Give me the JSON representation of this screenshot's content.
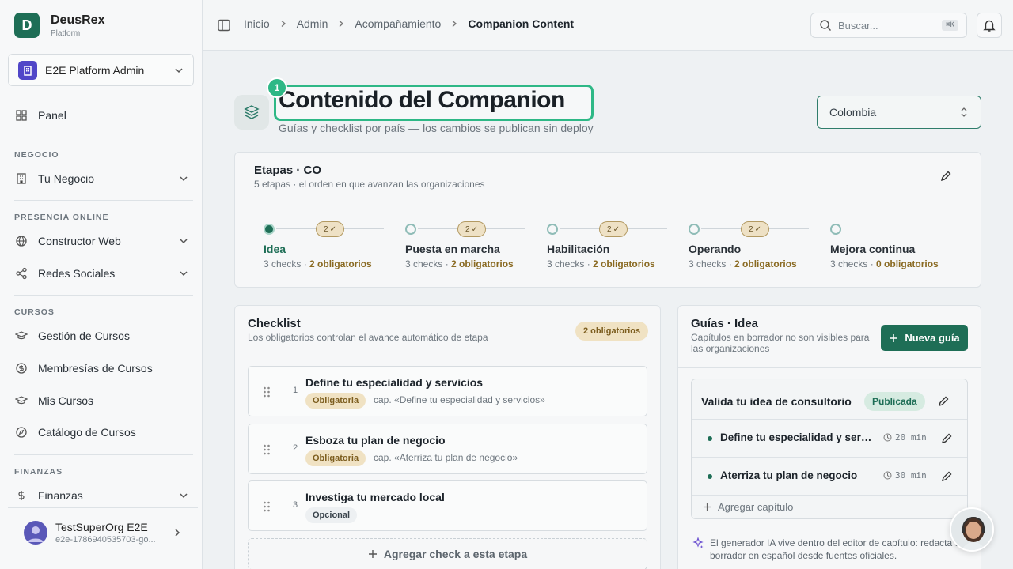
{
  "brand": {
    "name": "DeusRex",
    "sub": "Platform",
    "letter": "D"
  },
  "org": {
    "name": "E2E Platform Admin"
  },
  "nav": {
    "panel": "Panel",
    "negocio_label": "NEGOCIO",
    "tu_negocio": "Tu Negocio",
    "presencia_label": "PRESENCIA ONLINE",
    "constructor": "Constructor Web",
    "redes": "Redes Sociales",
    "cursos_label": "CURSOS",
    "gestion": "Gestión de Cursos",
    "membresias": "Membresías de Cursos",
    "mis_cursos": "Mis Cursos",
    "catalogo": "Catálogo de Cursos",
    "finanzas_label": "FINANZAS",
    "finanzas": "Finanzas"
  },
  "user": {
    "name": "TestSuperOrg E2E",
    "email": "e2e-1786940535703-go..."
  },
  "breadcrumb": [
    "Inicio",
    "Admin",
    "Acompañamiento",
    "Companion Content"
  ],
  "search": {
    "placeholder": "Buscar...",
    "shortcut": "⌘K"
  },
  "page": {
    "title": "Contenido del Companion",
    "subtitle": "Guías y checklist por país — los cambios se publican sin deploy",
    "step_badge": "1",
    "country": "Colombia"
  },
  "stages": {
    "title": "Etapas · CO",
    "subtitle": "5 etapas · el orden en que avanzan las organizaciones",
    "items": [
      {
        "name": "Idea",
        "checks": "3 checks",
        "required": "2 obligatorios",
        "pill": "2"
      },
      {
        "name": "Puesta en marcha",
        "checks": "3 checks",
        "required": "2 obligatorios",
        "pill": "2"
      },
      {
        "name": "Habilitación",
        "checks": "3 checks",
        "required": "2 obligatorios",
        "pill": "2"
      },
      {
        "name": "Operando",
        "checks": "3 checks",
        "required": "2 obligatorios",
        "pill": "2"
      },
      {
        "name": "Mejora continua",
        "checks": "3 checks",
        "required": "0 obligatorios",
        "pill": ""
      }
    ]
  },
  "checklist": {
    "title": "Checklist",
    "subtitle": "Los obligatorios controlan el avance automático de etapa",
    "badge": "2 obligatorios",
    "items": [
      {
        "num": "1",
        "title": "Define tu especialidad y servicios",
        "tag": "Obligatoria",
        "cap": "cap. «Define tu especialidad y servicios»"
      },
      {
        "num": "2",
        "title": "Esboza tu plan de negocio",
        "tag": "Obligatoria",
        "cap": "cap. «Aterriza tu plan de negocio»"
      },
      {
        "num": "3",
        "title": "Investiga tu mercado local",
        "tag": "Opcional",
        "cap": ""
      }
    ],
    "add": "Agregar check a esta etapa"
  },
  "guides": {
    "title": "Guías · Idea",
    "subtitle": "Capítulos en borrador no son visibles para las organizaciones",
    "new_button": "Nueva guía",
    "guide": {
      "title": "Valida tu idea de consultorio",
      "status": "Publicada",
      "chapters": [
        {
          "title": "Define tu especialidad y servicios",
          "mins": "20 min"
        },
        {
          "title": "Aterriza tu plan de negocio",
          "mins": "30 min"
        }
      ],
      "add_chapter": "Agregar capítulo"
    },
    "ai_note": "El generador IA vive dentro del editor de capítulo: redacta un borrador en español desde fuentes oficiales."
  },
  "colors": {
    "accent": "#1e6e56",
    "highlight": "#2eb886",
    "required": "#8a6a22"
  }
}
